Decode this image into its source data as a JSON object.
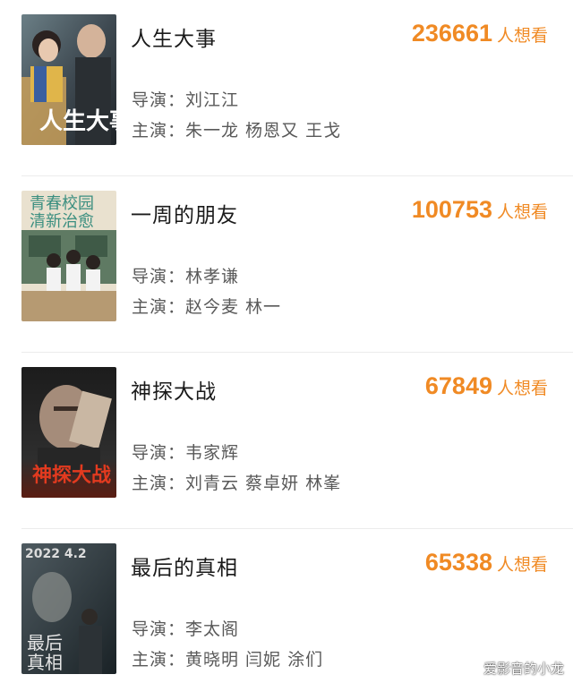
{
  "movies": [
    {
      "title": "人生大事",
      "want_count": "236661",
      "want_label": "人想看",
      "director": "导演：刘江江",
      "cast": "主演：朱一龙 杨恩又 王戈",
      "poster_icon": "movie-poster"
    },
    {
      "title": "一周的朋友",
      "want_count": "100753",
      "want_label": "人想看",
      "director": "导演：林孝谦",
      "cast": "主演：赵今麦 林一",
      "poster_icon": "movie-poster"
    },
    {
      "title": "神探大战",
      "want_count": "67849",
      "want_label": "人想看",
      "director": "导演：韦家辉",
      "cast": "主演：刘青云 蔡卓妍 林峯",
      "poster_icon": "movie-poster"
    },
    {
      "title": "最后的真相",
      "want_count": "65338",
      "want_label": "人想看",
      "director": "导演：李太阁",
      "cast": "主演：黄晓明 闫妮 涂们",
      "poster_icon": "movie-poster"
    }
  ],
  "posters": {
    "p2_text_line1": "青春校园",
    "p2_text_line2": "清新治愈",
    "p4_year": "2022 4.2"
  },
  "watermark": "爱影音的小龙",
  "colors": {
    "accent": "#f08a24",
    "title": "#1a1a1a",
    "info": "#595959"
  }
}
